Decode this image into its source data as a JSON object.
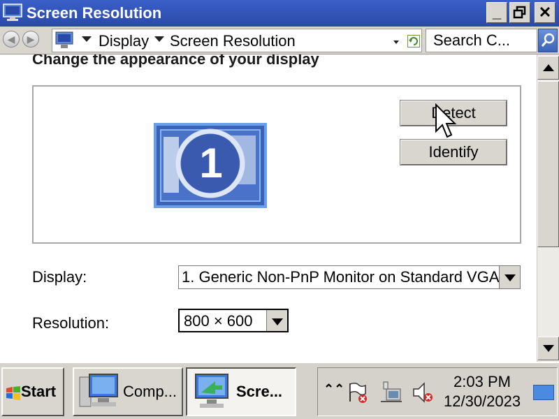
{
  "window": {
    "title": "Screen Resolution",
    "buttons": {
      "minimize": "_",
      "maximize": "🗗",
      "close": "✕"
    }
  },
  "addressbar": {
    "breadcrumb": [
      "Display",
      "Screen Resolution"
    ],
    "search_placeholder": "Search C..."
  },
  "content": {
    "heading": "Change the appearance of your display",
    "monitor_number": "1",
    "detect_label": "Detect",
    "identify_label": "Identify",
    "display_label": "Display:",
    "display_value": "1. Generic Non-PnP Monitor on Standard VGA",
    "resolution_label": "Resolution:",
    "resolution_value": "800 × 600"
  },
  "taskbar": {
    "start_label": "Start",
    "tasks": [
      {
        "label": "Comp...",
        "icon": "computer-icon"
      },
      {
        "label": "Scre...",
        "icon": "screen-resolution-icon",
        "active": true
      }
    ],
    "tray": {
      "icons": [
        "action-center-flag-icon",
        "network-icon",
        "volume-muted-icon"
      ],
      "time": "2:03 PM",
      "date": "12/30/2023"
    }
  },
  "colors": {
    "titlebar": "#3a5fc8",
    "monitor_blue": "#3a62b8",
    "window_bg": "#d8d6ce"
  }
}
